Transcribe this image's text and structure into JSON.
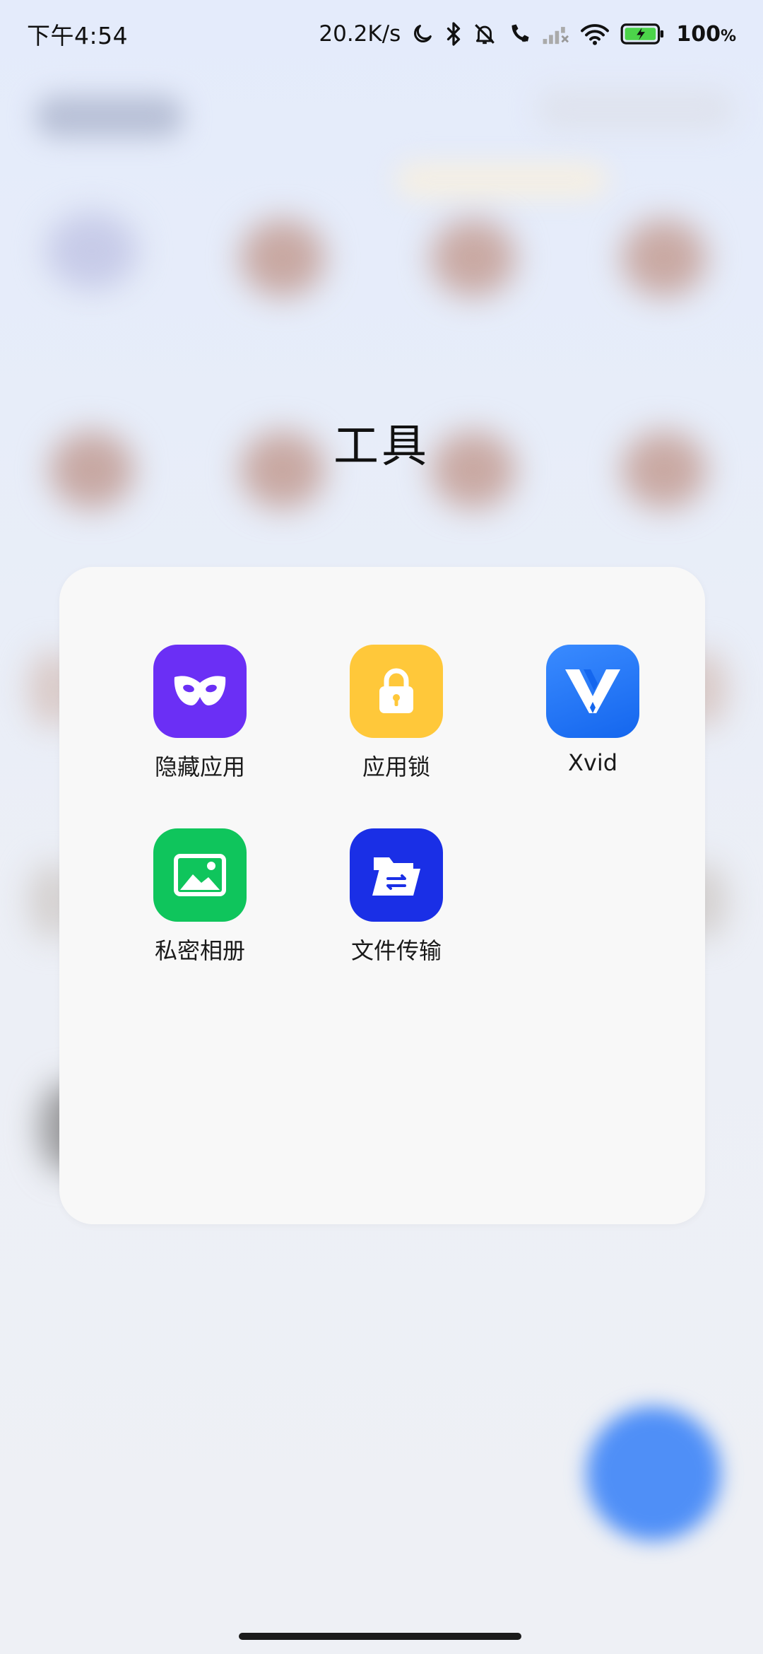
{
  "status_bar": {
    "time": "下午4:54",
    "net_speed": "20.2K/s",
    "battery_percent": "100",
    "battery_unit": "%",
    "icons": [
      "moon-icon",
      "bluetooth-icon",
      "bell-muted-icon",
      "call-forward-icon",
      "signal-off-icon",
      "wifi-icon",
      "battery-charging-icon"
    ]
  },
  "folder": {
    "title": "工具",
    "apps": [
      {
        "label": "隐藏应用",
        "icon": "mask-icon",
        "color": "#6b2ff5"
      },
      {
        "label": "应用锁",
        "icon": "lock-icon",
        "color": "#ffc83a"
      },
      {
        "label": "Xvid",
        "icon": "xvid-logo-icon",
        "color": "#1d6ff2"
      },
      {
        "label": "私密相册",
        "icon": "photo-icon",
        "color": "#0fc55c"
      },
      {
        "label": "文件传输",
        "icon": "folder-transfer-icon",
        "color": "#1a2fe6"
      }
    ]
  },
  "colors": {
    "background": "#e9eef8",
    "panel": "#f8f8f8",
    "fab": "#4f8ff7"
  }
}
